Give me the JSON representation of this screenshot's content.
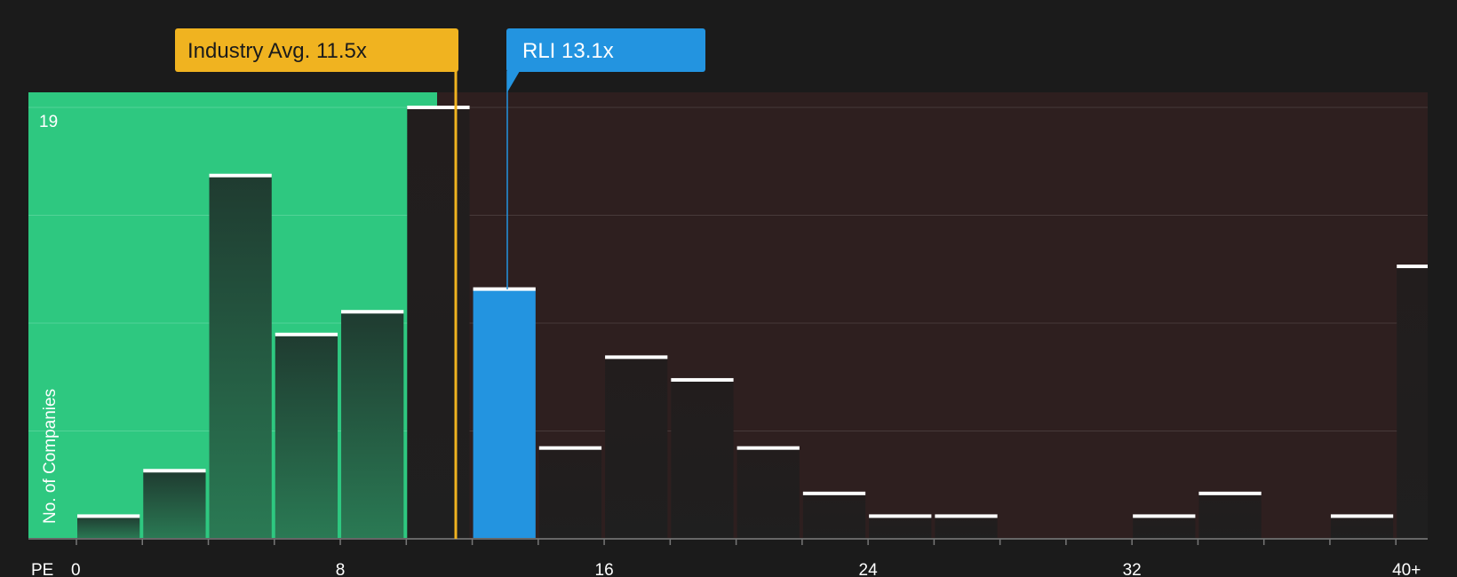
{
  "chart_data": {
    "type": "bar",
    "xlabel": "PE",
    "ylabel": "No. of Companies",
    "x_ticks": [
      "0",
      "8",
      "16",
      "24",
      "32",
      "40+"
    ],
    "y_max_label": "19",
    "ylim": [
      0,
      19
    ],
    "xlim": [
      -1.5,
      41.5
    ],
    "bin_width": 2,
    "bins": [
      {
        "start": 0,
        "value": 1
      },
      {
        "start": 2,
        "value": 3
      },
      {
        "start": 4,
        "value": 16
      },
      {
        "start": 6,
        "value": 9
      },
      {
        "start": 8,
        "value": 10
      },
      {
        "start": 10,
        "value": 19
      },
      {
        "start": 12,
        "value": 11,
        "highlight": true
      },
      {
        "start": 14,
        "value": 4
      },
      {
        "start": 16,
        "value": 8
      },
      {
        "start": 18,
        "value": 7
      },
      {
        "start": 20,
        "value": 4
      },
      {
        "start": 22,
        "value": 2
      },
      {
        "start": 24,
        "value": 1
      },
      {
        "start": 26,
        "value": 1
      },
      {
        "start": 32,
        "value": 1
      },
      {
        "start": 34,
        "value": 2
      },
      {
        "start": 38,
        "value": 1
      },
      {
        "start": 40,
        "value": 12
      }
    ],
    "gridlines": [
      0,
      4.75,
      9.5,
      14.25,
      19
    ],
    "industry_avg": {
      "label": "Industry Avg. 11.5x",
      "value": 11.5
    },
    "company": {
      "label": "RLI 13.1x",
      "value": 13.1
    },
    "colors": {
      "background": "#1b1b1b",
      "good_region": "#2ec880",
      "bad_region": "#2e1f1f",
      "industry": "#f0b320",
      "company": "#2394e0",
      "bar_dark": "#1f1f1f",
      "bar_cap": "#ffffff"
    }
  }
}
